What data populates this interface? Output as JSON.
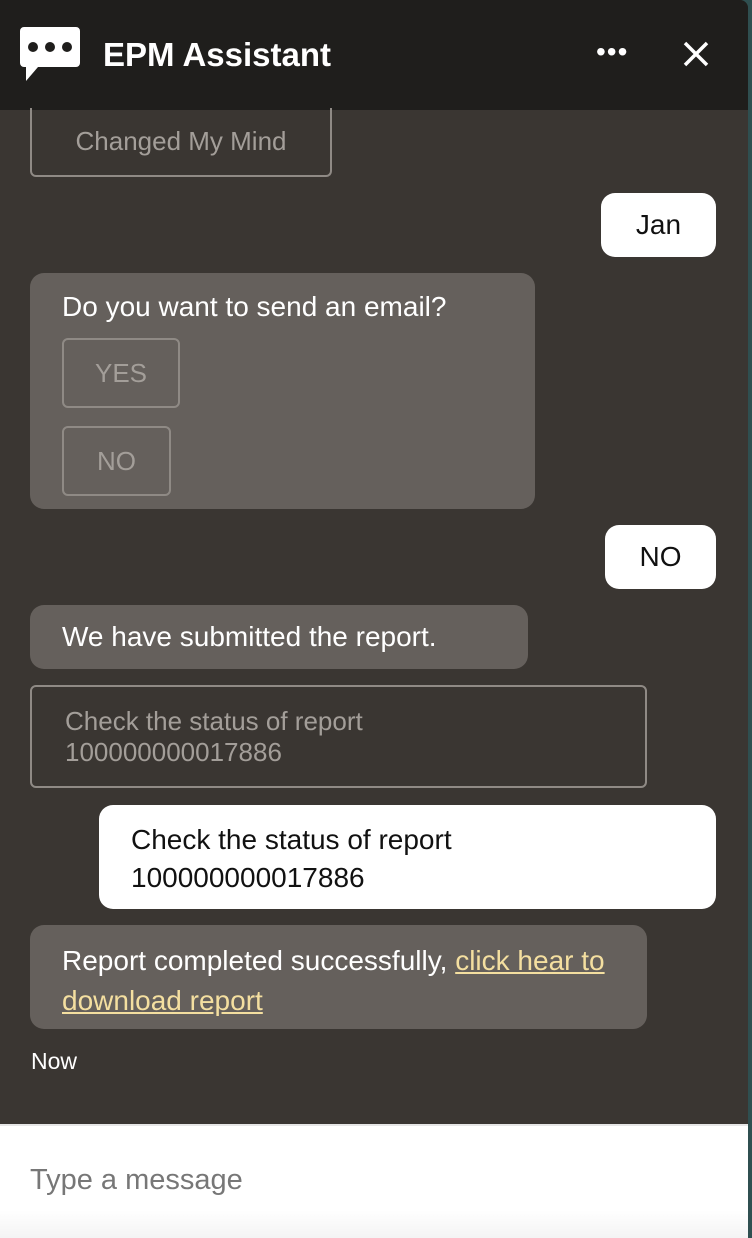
{
  "header": {
    "title": "EPM Assistant",
    "more_icon": "ellipsis-icon",
    "close_icon": "close-icon",
    "logo_icon": "chat-bubble-icon"
  },
  "messages": {
    "changed_mind": "Changed My Mind",
    "user_jan": "Jan",
    "email_question": "Do you want to send an email?",
    "yes": "YES",
    "no": "NO",
    "user_no": "NO",
    "submitted": "We have submitted the report.",
    "check_status_line1": "Check the status of report",
    "check_status_line2": "100000000017886",
    "user_check_line1": "Check the status of report",
    "user_check_line2": "100000000017886",
    "report_done": "Report completed successfully, ",
    "report_link": "click hear to download report",
    "timestamp": "Now"
  },
  "input": {
    "placeholder": "Type a message",
    "value": ""
  },
  "colors": {
    "header": "#1f1e1c",
    "background": "#3a3632",
    "bot_bubble": "#65605c",
    "user_bubble": "#ffffff",
    "link": "#f4dfa0"
  }
}
